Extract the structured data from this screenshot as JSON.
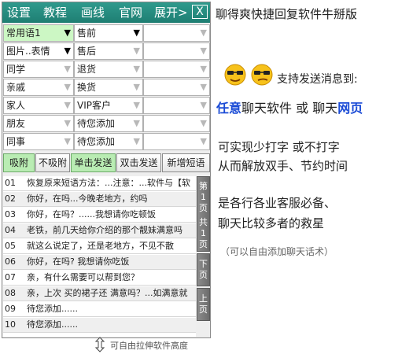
{
  "menubar": {
    "items": [
      "设置",
      "教程",
      "画线",
      "官网",
      "展开>"
    ],
    "close_label": "X"
  },
  "categories": [
    {
      "col1": "常用语1",
      "col2": "售前",
      "col3": ""
    },
    {
      "col1": "图片..表情",
      "col2": "售后",
      "col3": ""
    },
    {
      "col1": "同学",
      "col2": "退货",
      "col3": ""
    },
    {
      "col1": "亲戚",
      "col2": "换货",
      "col3": ""
    },
    {
      "col1": "家人",
      "col2": "VIP客户",
      "col3": ""
    },
    {
      "col1": "朋友",
      "col2": "待您添加",
      "col3": ""
    },
    {
      "col1": "同事",
      "col2": "待您添加",
      "col3": ""
    }
  ],
  "buttons": [
    "吸附",
    "不吸附",
    "单击发送",
    "双击发送",
    "新增短语"
  ],
  "phrases": [
    {
      "num": "01",
      "text": "恢复原来短语方法：...注意：...软件与【软"
    },
    {
      "num": "02",
      "text": "你好，在吗...今晚老地方，约吗"
    },
    {
      "num": "03",
      "text": "你好，在吗？......我想请你吃顿饭"
    },
    {
      "num": "04",
      "text": "老铁，前几天给你介绍的那个靓妹满意吗"
    },
    {
      "num": "05",
      "text": "就这么说定了，还是老地方，不见不散"
    },
    {
      "num": "06",
      "text": "你好，在吗? 我想请你吃饭"
    },
    {
      "num": "07",
      "text": "亲，有什么需要可以帮到您？"
    },
    {
      "num": "08",
      "text": "亲，上次 买的裙子还 满意吗？...如满意就"
    },
    {
      "num": "09",
      "text": "待您添加......"
    },
    {
      "num": "10",
      "text": "待您添加......"
    }
  ],
  "pager": {
    "page_info": [
      "第",
      "1",
      "页",
      "共",
      "1",
      "页"
    ],
    "next": [
      "下",
      "页"
    ],
    "prev": [
      "上",
      "页"
    ]
  },
  "drag_hint": "可自由拉伸软件高度",
  "description": {
    "title": "聊得爽快捷回复软件牛掰版",
    "support": "支持发送消息到:",
    "chat_prefix": "任意",
    "chat_mid1": "聊天软件 或 聊天",
    "chat_highlight": "网页",
    "line1": "可实现少打字 或不打字",
    "line2": "从而解放双手、节约时间",
    "line3": "是各行各业客服必备、",
    "line4": "聊天比较多者的救星",
    "note": "（可以自由添加聊天话术）"
  },
  "colors": {
    "menubar": "#1e7e72",
    "selected": "#ccf7c4",
    "highlight_blue": "#1a4bd6"
  }
}
